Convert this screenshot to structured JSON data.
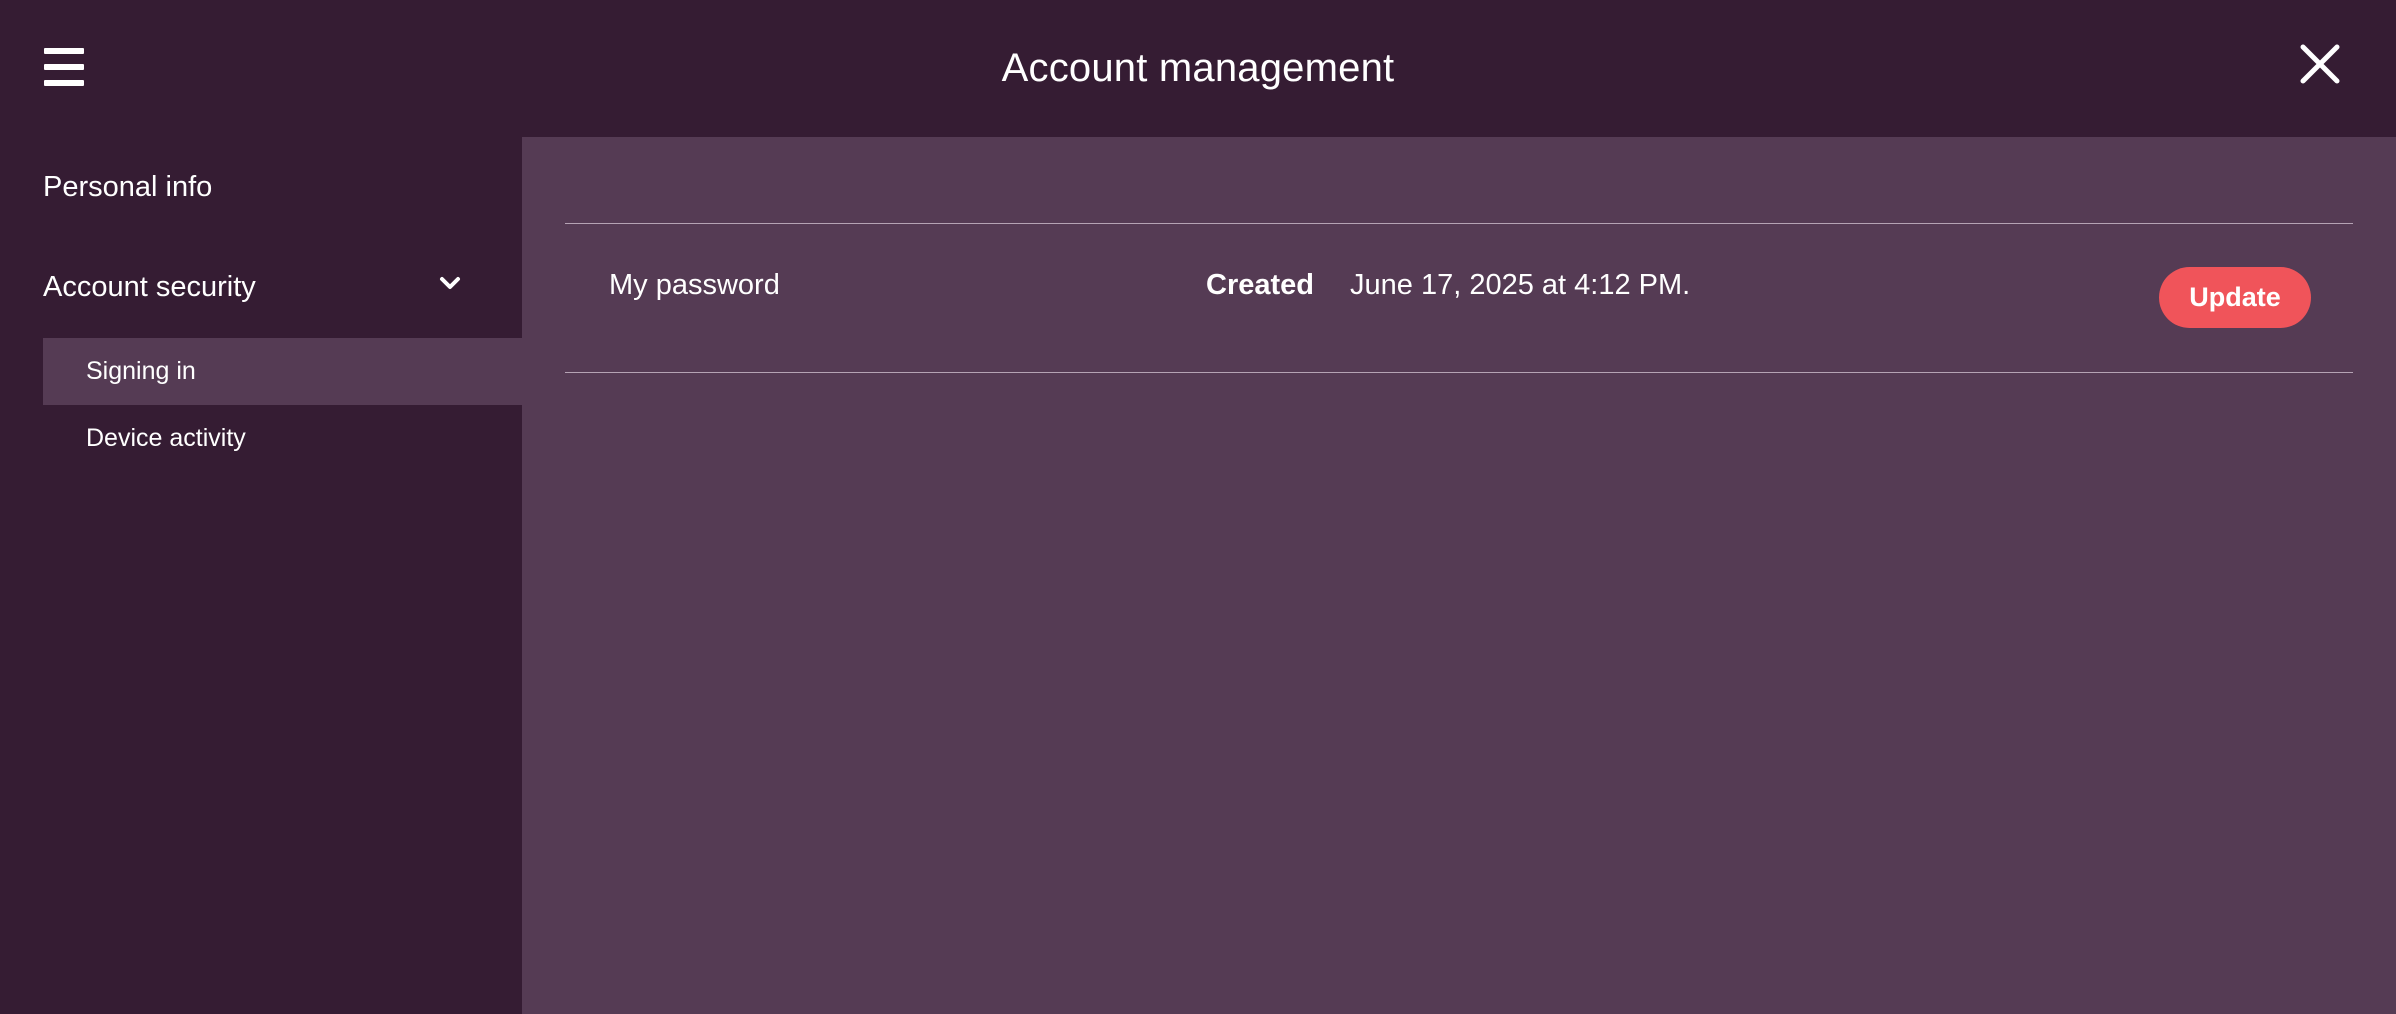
{
  "header": {
    "title": "Account management",
    "menu_icon": "hamburger-menu-icon",
    "close_icon": "close-icon"
  },
  "sidebar": {
    "items": [
      {
        "label": "Personal info"
      },
      {
        "label": "Account security",
        "expanded": true,
        "icon": "chevron-down-icon",
        "subitems": [
          {
            "label": "Signing in",
            "active": true
          },
          {
            "label": "Device activity",
            "active": false
          }
        ]
      }
    ]
  },
  "main": {
    "password_row": {
      "label": "My password",
      "created_label": "Created",
      "created_value": "June 17, 2025 at 4:12 PM.",
      "update_button": "Update"
    }
  },
  "colors": {
    "background": "#351c33",
    "content_background": "#553b54",
    "active_item": "#553b54",
    "accent": "#f0545a",
    "text": "#ffffff",
    "divider": "#b5a3b4"
  }
}
